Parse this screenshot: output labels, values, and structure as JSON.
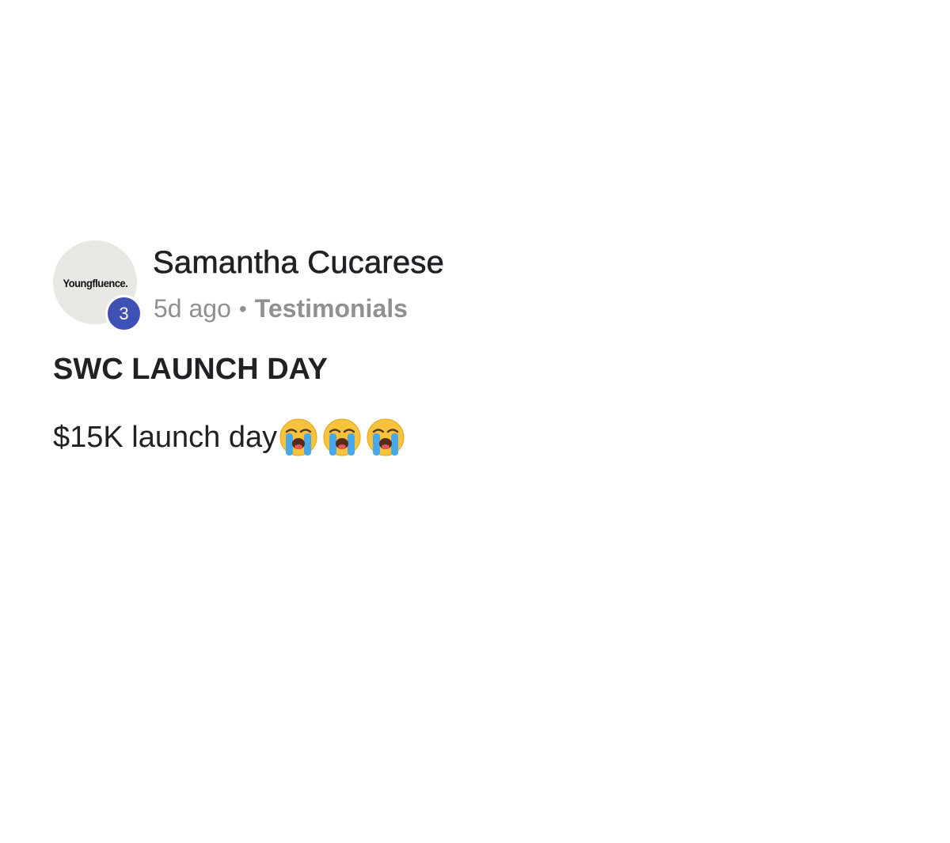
{
  "post": {
    "avatar_text": "Youngfluence.",
    "level": "3",
    "author": "Samantha Cucarese",
    "time_ago": "5d ago",
    "separator": "•",
    "category": "Testimonials",
    "title": "SWC LAUNCH DAY",
    "body_text": "$15K launch day",
    "emojis": [
      "loudly-crying-face-icon",
      "loudly-crying-face-icon",
      "loudly-crying-face-icon"
    ]
  },
  "colors": {
    "badge": "#3f51b5",
    "avatar_bg": "#e8e7e3",
    "meta_text": "#909090",
    "primary_text": "#202124"
  }
}
